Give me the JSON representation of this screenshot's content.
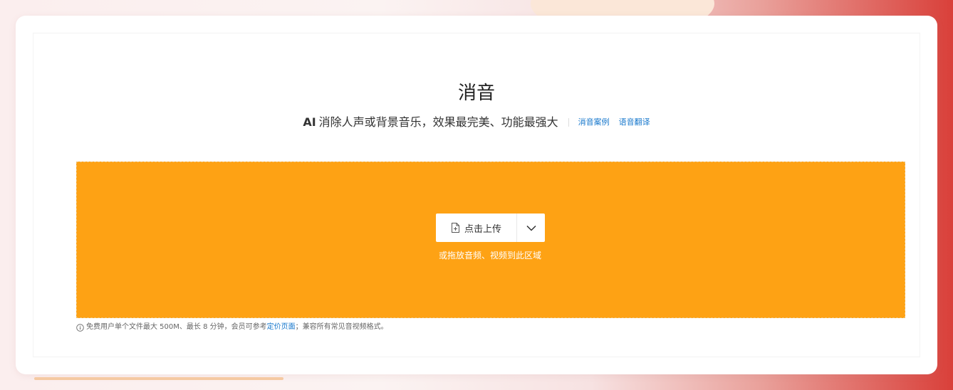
{
  "page": {
    "title": "消音",
    "subtitle_prefix": "AI",
    "subtitle_text": "消除人声或背景音乐，效果最完美、功能最强大",
    "links": [
      {
        "label": "消音案例"
      },
      {
        "label": "语音翻译"
      }
    ]
  },
  "upload": {
    "button_label": "点击上传",
    "button_icon": "file-upload-icon",
    "dropdown_icon": "chevron-down-icon",
    "drop_hint": "或拖放音频、视频到此区域"
  },
  "note": {
    "icon": "info-icon",
    "text_before": "免费用户单个文件最大 500M、最长 8 分钟，会员可参考",
    "link_label": "定价页面",
    "text_after": "；兼容所有常见音视频格式。"
  },
  "colors": {
    "drop_zone": "#fea214",
    "link": "#1677cc",
    "accent_red": "#d9403a"
  }
}
